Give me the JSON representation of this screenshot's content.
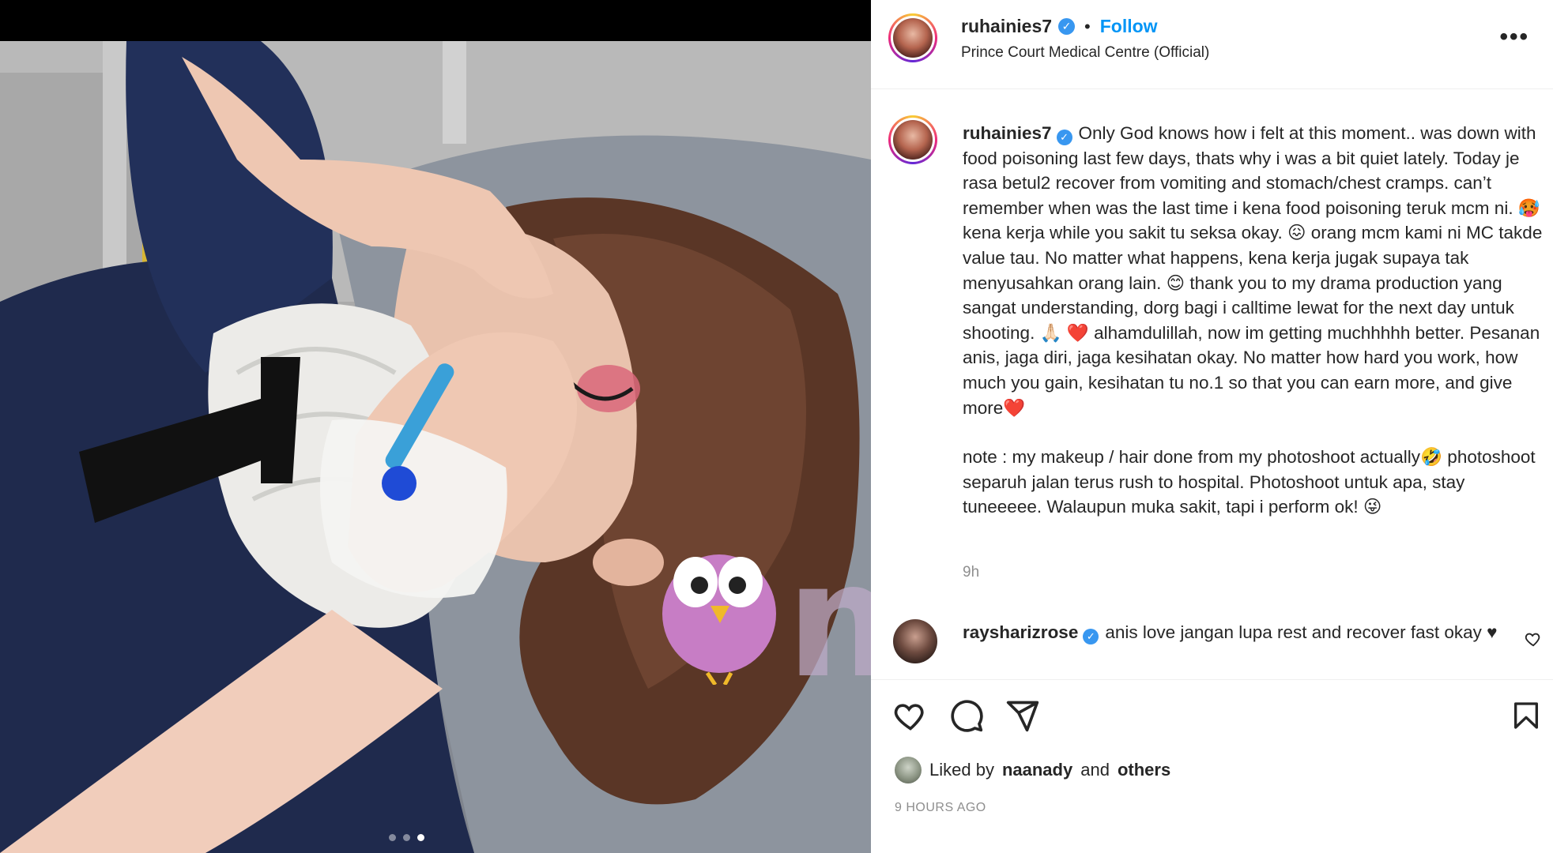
{
  "post": {
    "username": "ruhainies7",
    "follow_label": "Follow",
    "separator": "•",
    "location": "Prince Court Medical Centre (Official)",
    "more_label": "•••"
  },
  "caption": {
    "username": "ruhainies7",
    "paragraphs": [
      "Only God knows how i felt at this moment.. was down with food poisoning last few days, thats why i was a bit quiet lately. Today je rasa betul2 recover from vomiting and stomach/chest cramps. can’t remember when was the last time i kena food poisoning teruk mcm ni. 🥵 kena kerja while you sakit tu seksa okay. 😖 orang mcm kami ni MC takde value tau. No matter what happens, kena kerja jugak supaya tak menyusahkan orang lain. 😊 thank you to my drama production yang sangat understanding, dorg bagi i calltime lewat for the next day untuk shooting. 🙏🏻 ❤️ alhamdulillah, now im getting muchhhhh better. Pesanan anis, jaga diri, jaga kesihatan okay. No matter how hard you work, how much you gain, kesihatan tu no.1 so that you can earn more, and give more❤️",
      "note : my makeup / hair done from my photoshoot actually🤣 photoshoot separuh jalan terus rush to hospital. Photoshoot untuk apa, stay tuneeeee. Walaupun muka sakit, tapi i perform ok! 😜"
    ],
    "time": "9h"
  },
  "comment": {
    "username": "raysharizrose",
    "text": "anis love jangan lupa rest and recover fast okay ♥"
  },
  "likes": {
    "prefix": "Liked by",
    "user": "naanady",
    "and": "and",
    "others": "others"
  },
  "timestamp": "9 HOURS AGO",
  "watermark": "murai",
  "carousel": {
    "count": 3,
    "active_index": 2
  },
  "colors": {
    "accent": "#0095f6",
    "verified": "#3897f0",
    "muted": "#8e8e8e",
    "text": "#262626"
  },
  "icons": [
    "verified-badge-icon",
    "more-options-icon",
    "heart-icon",
    "comment-icon",
    "share-icon",
    "bookmark-icon",
    "small-heart-icon"
  ]
}
